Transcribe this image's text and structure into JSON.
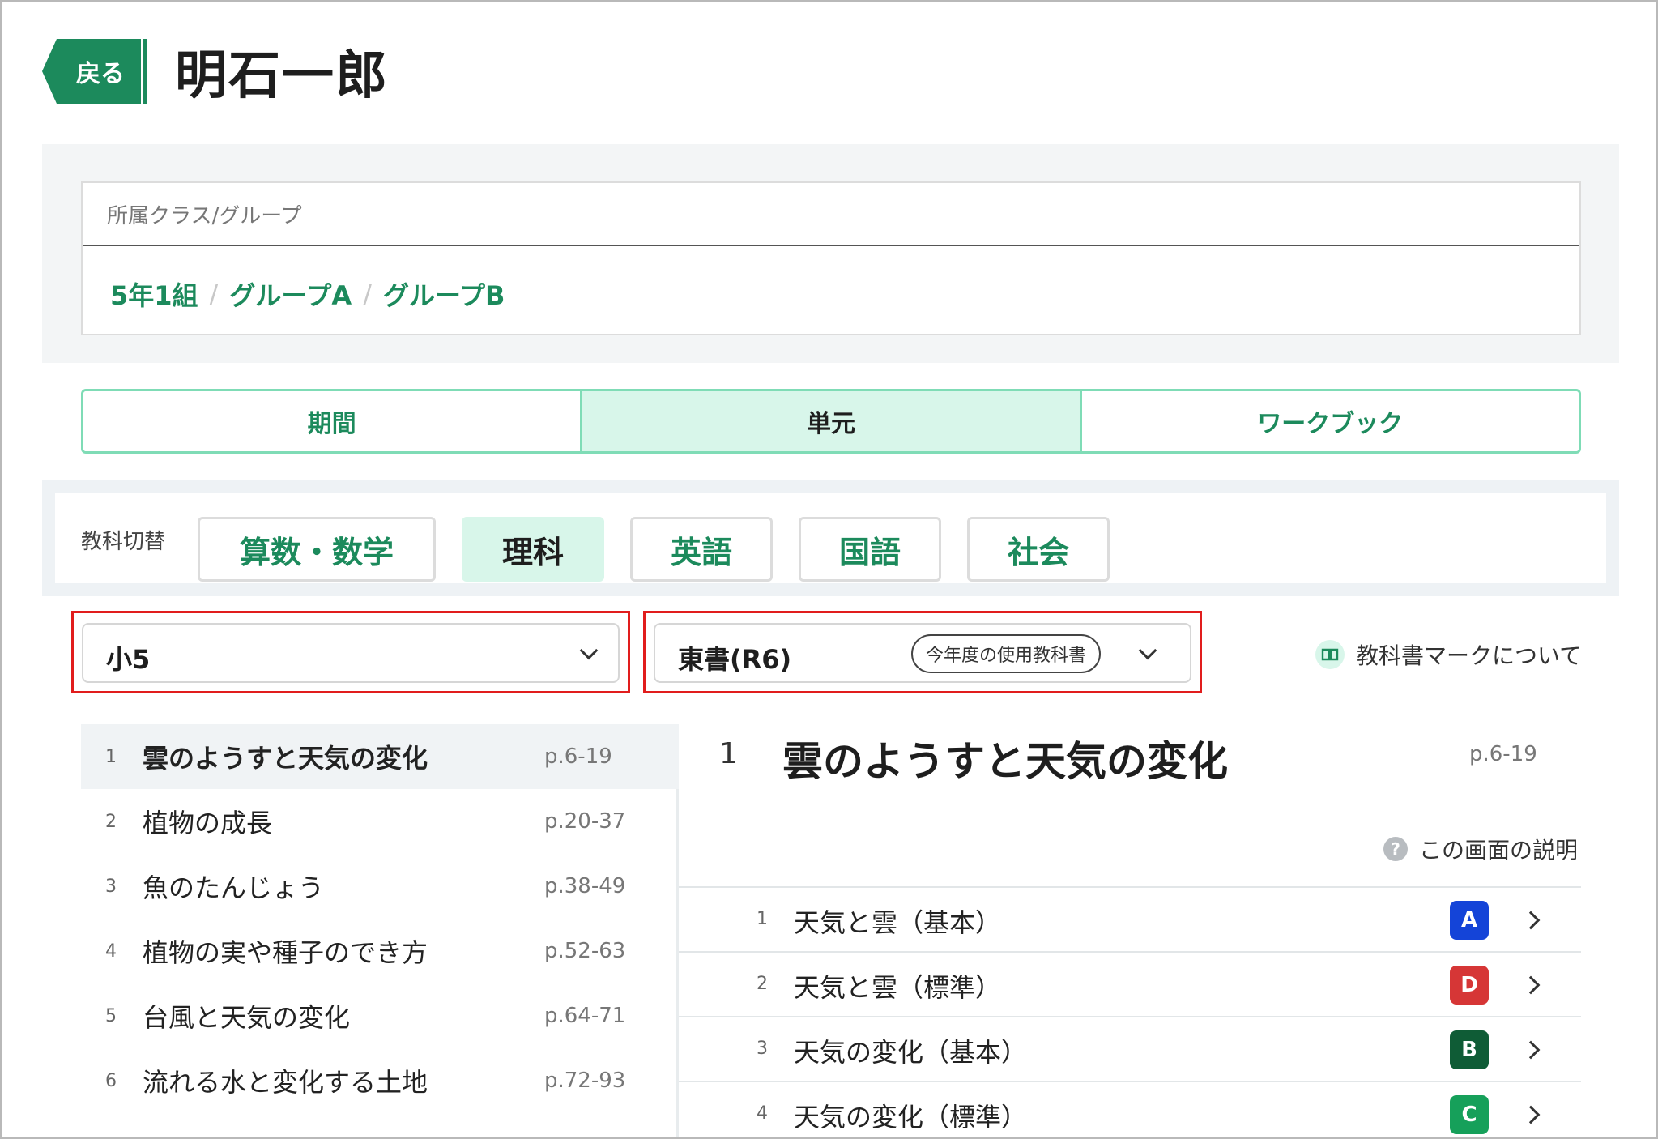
{
  "header": {
    "back_label": "戻る",
    "title": "明石一郎"
  },
  "class_panel": {
    "label": "所属クラス/グループ",
    "groups": [
      "5年1組",
      "グループA",
      "グループB"
    ],
    "separator": "/"
  },
  "mode_tabs": [
    {
      "label": "期間",
      "active": false
    },
    {
      "label": "単元",
      "active": true
    },
    {
      "label": "ワークブック",
      "active": false
    }
  ],
  "subject_switch": {
    "label": "教科切替",
    "subjects": [
      {
        "label": "算数・数学",
        "active": false
      },
      {
        "label": "理科",
        "active": true
      },
      {
        "label": "英語",
        "active": false
      },
      {
        "label": "国語",
        "active": false
      },
      {
        "label": "社会",
        "active": false
      }
    ]
  },
  "grade_select": {
    "value": "小5"
  },
  "textbook_select": {
    "value": "東書(R6)",
    "badge": "今年度の使用教科書"
  },
  "textbook_mark_link": {
    "icon": "book-icon",
    "label": "教科書マークについて"
  },
  "units": [
    {
      "num": "1",
      "title": "雲のようすと天気の変化",
      "pages": "p.6-19",
      "active": true
    },
    {
      "num": "2",
      "title": "植物の成長",
      "pages": "p.20-37",
      "active": false
    },
    {
      "num": "3",
      "title": "魚のたんじょう",
      "pages": "p.38-49",
      "active": false
    },
    {
      "num": "4",
      "title": "植物の実や種子のでき方",
      "pages": "p.52-63",
      "active": false
    },
    {
      "num": "5",
      "title": "台風と天気の変化",
      "pages": "p.64-71",
      "active": false
    },
    {
      "num": "6",
      "title": "流れる水と変化する土地",
      "pages": "p.72-93",
      "active": false
    }
  ],
  "detail": {
    "num": "1",
    "title": "雲のようすと天気の変化",
    "pages": "p.6-19",
    "help_label": "この画面の説明",
    "lessons": [
      {
        "num": "1",
        "title": "天気と雲（基本）",
        "badge": "A",
        "badge_color": "#1444d8"
      },
      {
        "num": "2",
        "title": "天気と雲（標準）",
        "badge": "D",
        "badge_color": "#d63636"
      },
      {
        "num": "3",
        "title": "天気の変化（基本）",
        "badge": "B",
        "badge_color": "#0f5c36"
      },
      {
        "num": "4",
        "title": "天気の変化（標準）",
        "badge": "C",
        "badge_color": "#16a05a"
      }
    ]
  },
  "colors": {
    "brand": "#1c8a5c",
    "active_bg": "#d8f6ea",
    "highlight": "#e11d1d"
  }
}
